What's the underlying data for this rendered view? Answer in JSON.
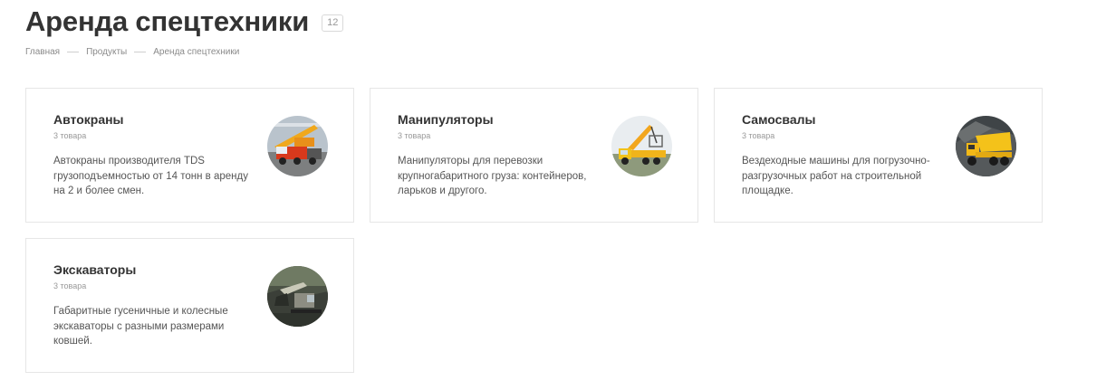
{
  "page": {
    "title": "Аренда спецтехники",
    "count": "12"
  },
  "breadcrumb": [
    "Главная",
    "Продукты",
    "Аренда спецтехники"
  ],
  "categories": [
    {
      "name": "Автокраны",
      "count": "3 товара",
      "description": "Автокраны производителя TDS грузоподъемностью от 14 тонн в аренду на 2 и более смен.",
      "icon": "truck-crane-photo"
    },
    {
      "name": "Манипуляторы",
      "count": "3 товара",
      "description": "Манипуляторы для перевозки крупногабаритного груза: контейнеров, ларьков и другого.",
      "icon": "manipulator-truck-photo"
    },
    {
      "name": "Самосвалы",
      "count": "3 товара",
      "description": "Вездеходные машины для погрузочно-разгрузочных работ на строительной площадке.",
      "icon": "dump-truck-photo"
    },
    {
      "name": "Экскаваторы",
      "count": "3 товара",
      "description": "Габаритные гусеничные и колесные экскаваторы с разными размерами ковшей.",
      "icon": "excavator-photo"
    }
  ],
  "colors": {
    "text": "#333333",
    "muted": "#999999",
    "border": "#e6e6e6"
  }
}
